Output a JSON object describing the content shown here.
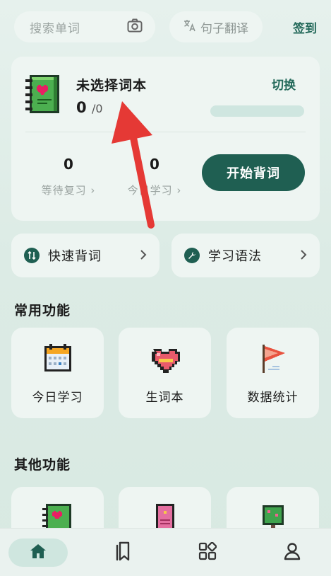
{
  "topbar": {
    "search_placeholder": "搜索单词",
    "translate_label": "句子翻译",
    "signin_label": "签到"
  },
  "book": {
    "title": "未选择词本",
    "learned": "0",
    "total": "/0",
    "progress": 0,
    "switch_label": "切换"
  },
  "stats": [
    {
      "value": "0",
      "label": "等待复习 ›"
    },
    {
      "value": "0",
      "label": "今日学习 ›"
    }
  ],
  "start_button": "开始背词",
  "quick_links": [
    {
      "label": "快速背词",
      "icon": "swap-icon"
    },
    {
      "label": "学习语法",
      "icon": "wrench-icon"
    }
  ],
  "common_title": "常用功能",
  "common_functions": [
    {
      "label": "今日学习",
      "icon": "calendar-icon"
    },
    {
      "label": "生词本",
      "icon": "heart-icon"
    },
    {
      "label": "数据统计",
      "icon": "flag-icon"
    }
  ],
  "other_title": "其他功能",
  "other_functions": [
    {
      "icon": "wordbook-icon"
    },
    {
      "icon": "pink-book-icon"
    },
    {
      "icon": "tree-icon"
    }
  ],
  "nav": [
    "home-icon",
    "bookmark-icon",
    "apps-icon",
    "profile-icon"
  ],
  "colors": {
    "accent": "#1f5f52",
    "background": "#e2efea",
    "card": "#eef5f2"
  }
}
